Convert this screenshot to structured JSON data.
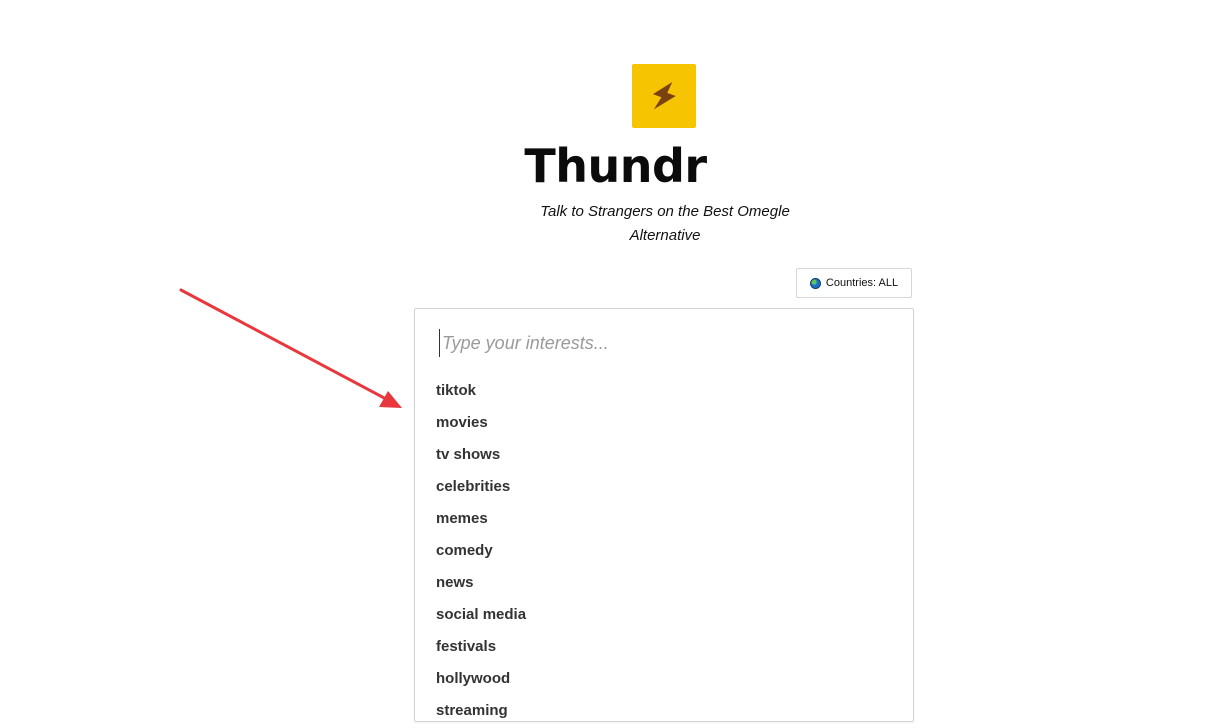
{
  "brand": {
    "logo_icon": "lightning-bolt-icon",
    "logo_bg": "#f6c400",
    "title": "Thundr",
    "subtitle": "Talk to Strangers on the Best Omegle Alternative"
  },
  "countries_button": {
    "icon": "globe-icon",
    "label": "Countries: ALL"
  },
  "interests": {
    "placeholder": "Type your interests...",
    "value": "",
    "suggestions": [
      "tiktok",
      "movies",
      "tv shows",
      "celebrities",
      "memes",
      "comedy",
      "news",
      "social media",
      "festivals",
      "hollywood",
      "streaming"
    ]
  },
  "annotation": {
    "type": "arrow",
    "color": "#e8383d"
  }
}
